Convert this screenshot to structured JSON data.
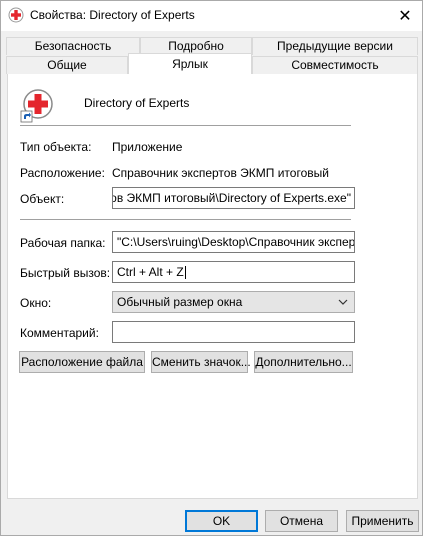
{
  "window": {
    "title": "Свойства: Directory of Experts",
    "close_glyph": "✕"
  },
  "tabs": {
    "row_back": [
      "Безопасность",
      "Подробно",
      "Предыдущие версии"
    ],
    "row_front": [
      "Общие",
      "Ярлык",
      "Совместимость"
    ],
    "active": "Ярлык"
  },
  "shortcut": {
    "app_name": "Directory of Experts",
    "type_label": "Тип объекта:",
    "type_value": "Приложение",
    "location_label": "Расположение:",
    "location_value": "Справочник экспертов ЭКМП итоговый",
    "target_label": "Объект:",
    "target_value": "тов ЭКМП итоговый\\Directory of Experts.exe\"",
    "startin_label": "Рабочая папка:",
    "startin_value": "\"C:\\Users\\ruing\\Desktop\\Справочник экспертов",
    "hotkey_label": "Быстрый вызов:",
    "hotkey_value": "Ctrl + Alt + Z",
    "run_label": "Окно:",
    "run_value": "Обычный размер окна",
    "comment_label": "Комментарий:",
    "comment_value": ""
  },
  "actions": {
    "open_location": "Расположение файла",
    "change_icon": "Сменить значок...",
    "advanced": "Дополнительно..."
  },
  "footer": {
    "ok": "OK",
    "cancel": "Отмена",
    "apply": "Применить"
  },
  "colors": {
    "accent": "#0078d7",
    "icon_red": "#e4262d"
  },
  "icons": [
    "app-icon",
    "close-icon",
    "shortcut-arrow-icon",
    "chevron-down-icon"
  ]
}
